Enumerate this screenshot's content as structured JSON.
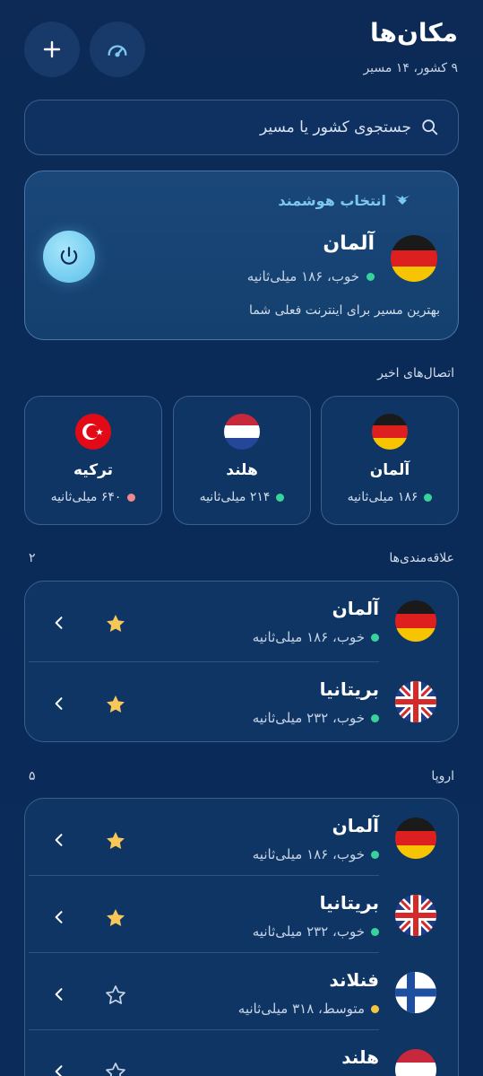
{
  "header": {
    "title": "مکان‌ها",
    "subtitle": "۹ کشور، ۱۴ مسیر",
    "speed_icon": "speedometer-icon",
    "add_icon": "plus-icon"
  },
  "search": {
    "placeholder": "جستجوی کشور یا مسیر",
    "icon": "search-icon"
  },
  "smart": {
    "heading": "انتخاب هوشمند",
    "country": "آلمان",
    "status": "خوب، ۱۸۶ میلی‌ثانیه",
    "note": "بهترین مسیر برای اینترنت فعلی شما",
    "power_icon": "power-icon"
  },
  "recent": {
    "label": "اتصال‌های اخیر",
    "items": [
      {
        "name": "آلمان",
        "latency": "۱۸۶ میلی‌ثانیه",
        "status_color": "#37d39b"
      },
      {
        "name": "هلند",
        "latency": "۲۱۴ میلی‌ثانیه",
        "status_color": "#37d39b"
      },
      {
        "name": "ترکیه",
        "latency": "۶۴۰ میلی‌ثانیه",
        "status_color": "#f08a8a"
      }
    ]
  },
  "favorites": {
    "label": "علاقه‌مندی‌ها",
    "count": "۲",
    "items": [
      {
        "name": "آلمان",
        "status": "خوب، ۱۸۶ میلی‌ثانیه",
        "starred": true
      },
      {
        "name": "بریتانیا",
        "status": "خوب، ۲۳۲ میلی‌ثانیه",
        "starred": true
      }
    ]
  },
  "europe": {
    "label": "اروپا",
    "count": "۵",
    "items": [
      {
        "name": "آلمان",
        "status": "خوب، ۱۸۶ میلی‌ثانیه",
        "starred": true
      },
      {
        "name": "بریتانیا",
        "status": "خوب، ۲۳۲ میلی‌ثانیه",
        "starred": true
      },
      {
        "name": "فنلاند",
        "status": "متوسط، ۳۱۸ میلی‌ثانیه",
        "starred": false
      },
      {
        "name": "هلند",
        "status": "",
        "starred": false
      }
    ]
  },
  "colors": {
    "accent": "#7cc8f0",
    "good": "#37d39b",
    "medium": "#f5c542",
    "bad": "#f08a8a",
    "star": "#f7c75a"
  }
}
